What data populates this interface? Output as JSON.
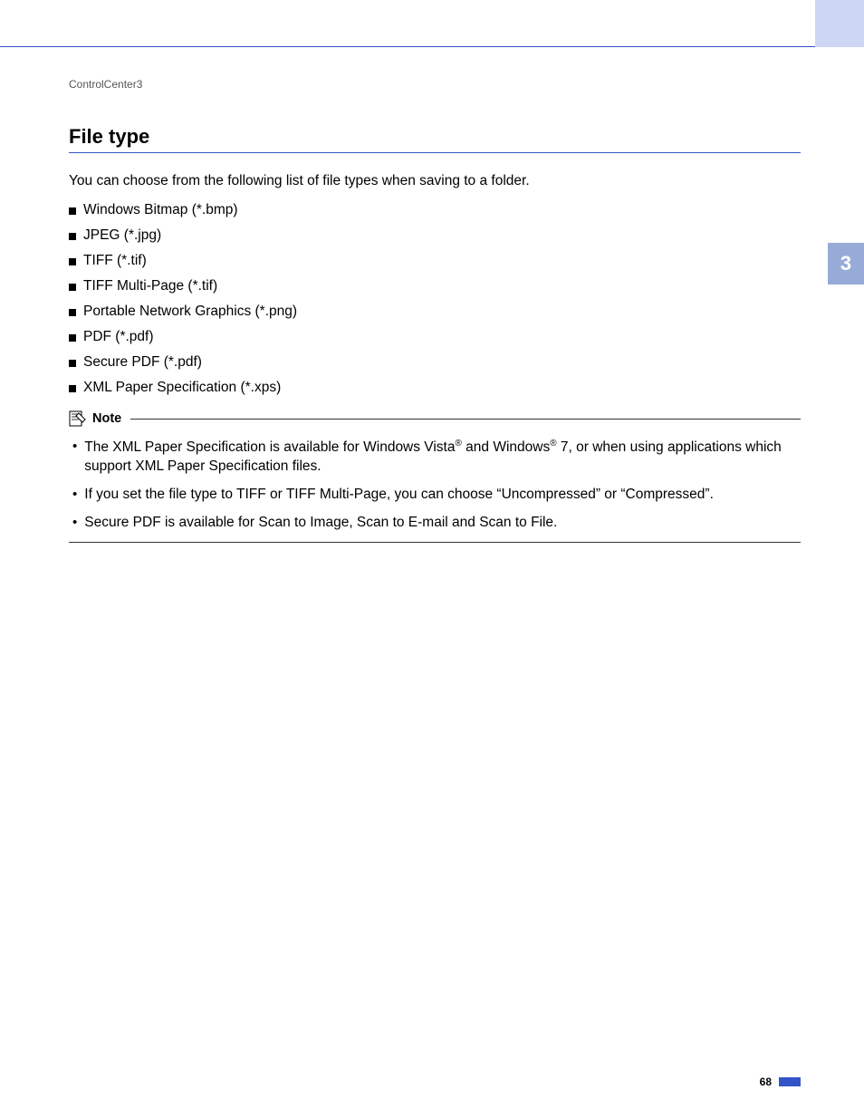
{
  "breadcrumb": "ControlCenter3",
  "heading": "File type",
  "intro": "You can choose from the following list of file types when saving to a folder.",
  "file_types": [
    "Windows Bitmap (*.bmp)",
    "JPEG (*.jpg)",
    "TIFF (*.tif)",
    "TIFF Multi-Page (*.tif)",
    "Portable Network Graphics (*.png)",
    "PDF (*.pdf)",
    "Secure PDF (*.pdf)",
    "XML Paper Specification (*.xps)"
  ],
  "note_label": "Note",
  "notes": [
    {
      "pre": "The XML Paper Specification is available for Windows Vista",
      "sup1": "®",
      "mid": " and Windows",
      "sup2": "®",
      "post": " 7, or when using applications which support XML Paper Specification files."
    },
    {
      "pre": "If you set the file type to TIFF or TIFF Multi-Page, you can choose “Uncompressed” or “Compressed”.",
      "sup1": "",
      "mid": "",
      "sup2": "",
      "post": ""
    },
    {
      "pre": "Secure PDF is available for Scan to Image, Scan to E-mail and Scan to File.",
      "sup1": "",
      "mid": "",
      "sup2": "",
      "post": ""
    }
  ],
  "side_tab": "3",
  "page_number": "68"
}
